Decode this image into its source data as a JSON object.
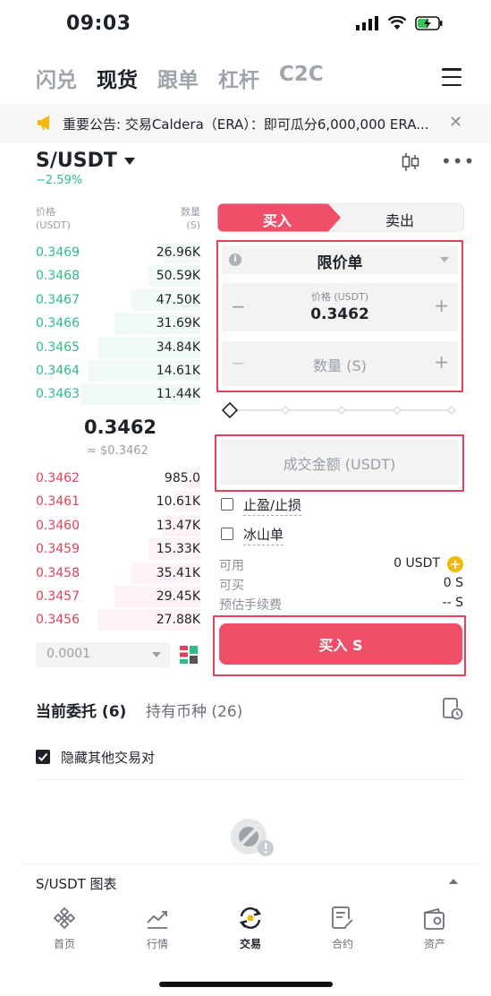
{
  "status_bar": {
    "time": "09:03"
  },
  "nav": {
    "tabs": [
      {
        "label": "闪兑",
        "active": false
      },
      {
        "label": "现货",
        "active": true
      },
      {
        "label": "跟单",
        "active": false
      },
      {
        "label": "杠杆",
        "active": false
      },
      {
        "label": "C2C",
        "active": false
      }
    ]
  },
  "announcement": {
    "text": "重要公告: 交易Caldera（ERA）：即可瓜分6,000,000 ERA..."
  },
  "pair": {
    "name": "S/USDT",
    "change": "−2.59%"
  },
  "orderbook": {
    "price_header": "价格",
    "price_unit": "(USDT)",
    "qty_header": "数量",
    "qty_unit": "(S)",
    "asks": [
      {
        "price": "0.3469",
        "qty": "26.96K",
        "depth": 0.22
      },
      {
        "price": "0.3468",
        "qty": "50.59K",
        "depth": 0.3
      },
      {
        "price": "0.3467",
        "qty": "47.50K",
        "depth": 0.4
      },
      {
        "price": "0.3466",
        "qty": "31.69K",
        "depth": 0.5
      },
      {
        "price": "0.3465",
        "qty": "34.84K",
        "depth": 0.6
      },
      {
        "price": "0.3464",
        "qty": "14.61K",
        "depth": 0.65
      },
      {
        "price": "0.3463",
        "qty": "11.44K",
        "depth": 0.7
      }
    ],
    "mid_price": "0.3462",
    "mid_usd": "≈ $0.3462",
    "bids": [
      {
        "price": "0.3462",
        "qty": "985.0",
        "depth": 0.1
      },
      {
        "price": "0.3461",
        "qty": "10.61K",
        "depth": 0.15
      },
      {
        "price": "0.3460",
        "qty": "13.47K",
        "depth": 0.22
      },
      {
        "price": "0.3459",
        "qty": "15.33K",
        "depth": 0.3
      },
      {
        "price": "0.3458",
        "qty": "35.41K",
        "depth": 0.4
      },
      {
        "price": "0.3457",
        "qty": "29.45K",
        "depth": 0.5
      },
      {
        "price": "0.3456",
        "qty": "27.88K",
        "depth": 0.6
      }
    ],
    "precision": "0.0001"
  },
  "form": {
    "buy_label": "买入",
    "sell_label": "卖出",
    "order_type": "限价单",
    "price_label": "价格 (USDT)",
    "price_value": "0.3462",
    "qty_placeholder": "数量 (S)",
    "amount_placeholder": "成交金额 (USDT)",
    "tpsl_label": "止盈/止损",
    "iceberg_label": "冰山单",
    "available_label": "可用",
    "available_value": "0 USDT",
    "can_buy_label": "可买",
    "can_buy_value": "0 S",
    "fee_label": "预估手续费",
    "fee_value": "-- S",
    "submit_label": "买入 S"
  },
  "orders": {
    "tab_open": "当前委托 (6)",
    "tab_holdings": "持有币种 (26)",
    "hide_others": "隐藏其他交易对"
  },
  "chart_bar": {
    "label": "S/USDT 图表"
  },
  "tabbar": [
    {
      "label": "首页",
      "icon": "binance-logo-icon",
      "active": false
    },
    {
      "label": "行情",
      "icon": "chart-icon",
      "active": false
    },
    {
      "label": "交易",
      "icon": "trade-icon",
      "active": true
    },
    {
      "label": "合约",
      "icon": "contract-icon",
      "active": false
    },
    {
      "label": "资产",
      "icon": "wallet-icon",
      "active": false
    }
  ],
  "colors": {
    "accent": "#ef4f69",
    "up": "#2ebd85",
    "down": "#e0415b",
    "highlight": "#e0415b"
  }
}
